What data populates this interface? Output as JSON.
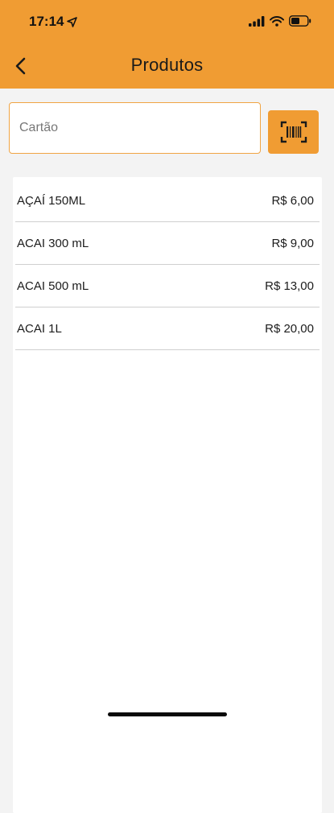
{
  "status_bar": {
    "time": "17:14"
  },
  "header": {
    "title": "Produtos",
    "back_icon": "chevron-left-icon"
  },
  "search": {
    "placeholder": "Cartão",
    "value": "",
    "scan_icon": "barcode-scan-icon"
  },
  "products": [
    {
      "name": "AÇAÍ 150ML",
      "price": "R$ 6,00"
    },
    {
      "name": "ACAI 300 mL",
      "price": "R$ 9,00"
    },
    {
      "name": "ACAI 500 mL",
      "price": "R$ 13,00"
    },
    {
      "name": "ACAI 1L",
      "price": "R$ 20,00"
    }
  ],
  "colors": {
    "accent": "#f09c33",
    "background": "#f3f3f3",
    "panel": "#ffffff"
  }
}
